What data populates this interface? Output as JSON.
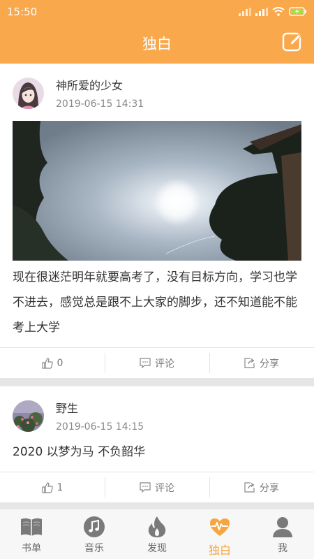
{
  "status_bar": {
    "time": "15:50"
  },
  "header": {
    "title": "独白",
    "edit_icon": "edit-icon"
  },
  "posts": [
    {
      "user": "神所爱的少女",
      "time": "2019-06-15 14:31",
      "text": "现在很迷茫明年就要高考了，没有目标方向，学习也学不进去，感觉总是跟不上大家的脚步，还不知道能不能考上大学",
      "has_photo": true,
      "likes": "0",
      "comment_label": "评论",
      "share_label": "分享"
    },
    {
      "user": "野生",
      "time": "2019-06-15 14:15",
      "text": "2020  以梦为马 不负韶华",
      "has_photo": false,
      "likes": "1",
      "comment_label": "评论",
      "share_label": "分享"
    }
  ],
  "tabs": [
    {
      "label": "书单",
      "icon": "book-icon",
      "active": false
    },
    {
      "label": "音乐",
      "icon": "music-icon",
      "active": false
    },
    {
      "label": "发现",
      "icon": "fire-icon",
      "active": false
    },
    {
      "label": "独白",
      "icon": "heartbeat-icon",
      "active": true
    },
    {
      "label": "我",
      "icon": "person-icon",
      "active": false
    }
  ],
  "colors": {
    "accent": "#f9a84c",
    "active_tab": "#f5a640",
    "muted_icon": "#888888"
  }
}
